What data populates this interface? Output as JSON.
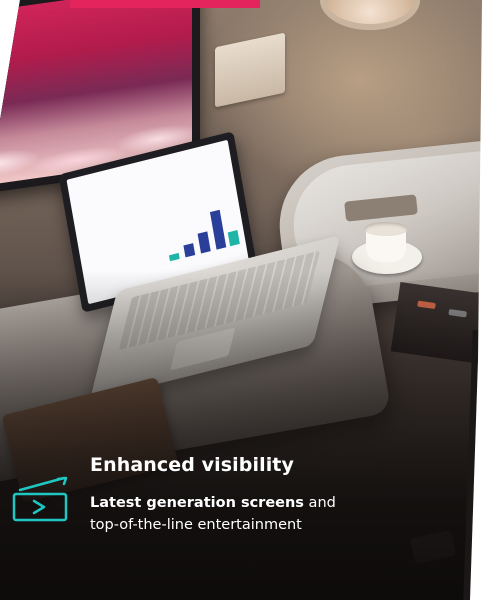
{
  "feature": {
    "title": "Enhanced visibility",
    "desc_bold": "Latest generation screens",
    "desc_rest": " and",
    "desc_line2": "top-of-the-line entertainment",
    "icon": "screen-play-icon"
  },
  "colors": {
    "accent": "#e4245c",
    "icon_teal": "#1fc7c2",
    "text": "#ffffff"
  }
}
